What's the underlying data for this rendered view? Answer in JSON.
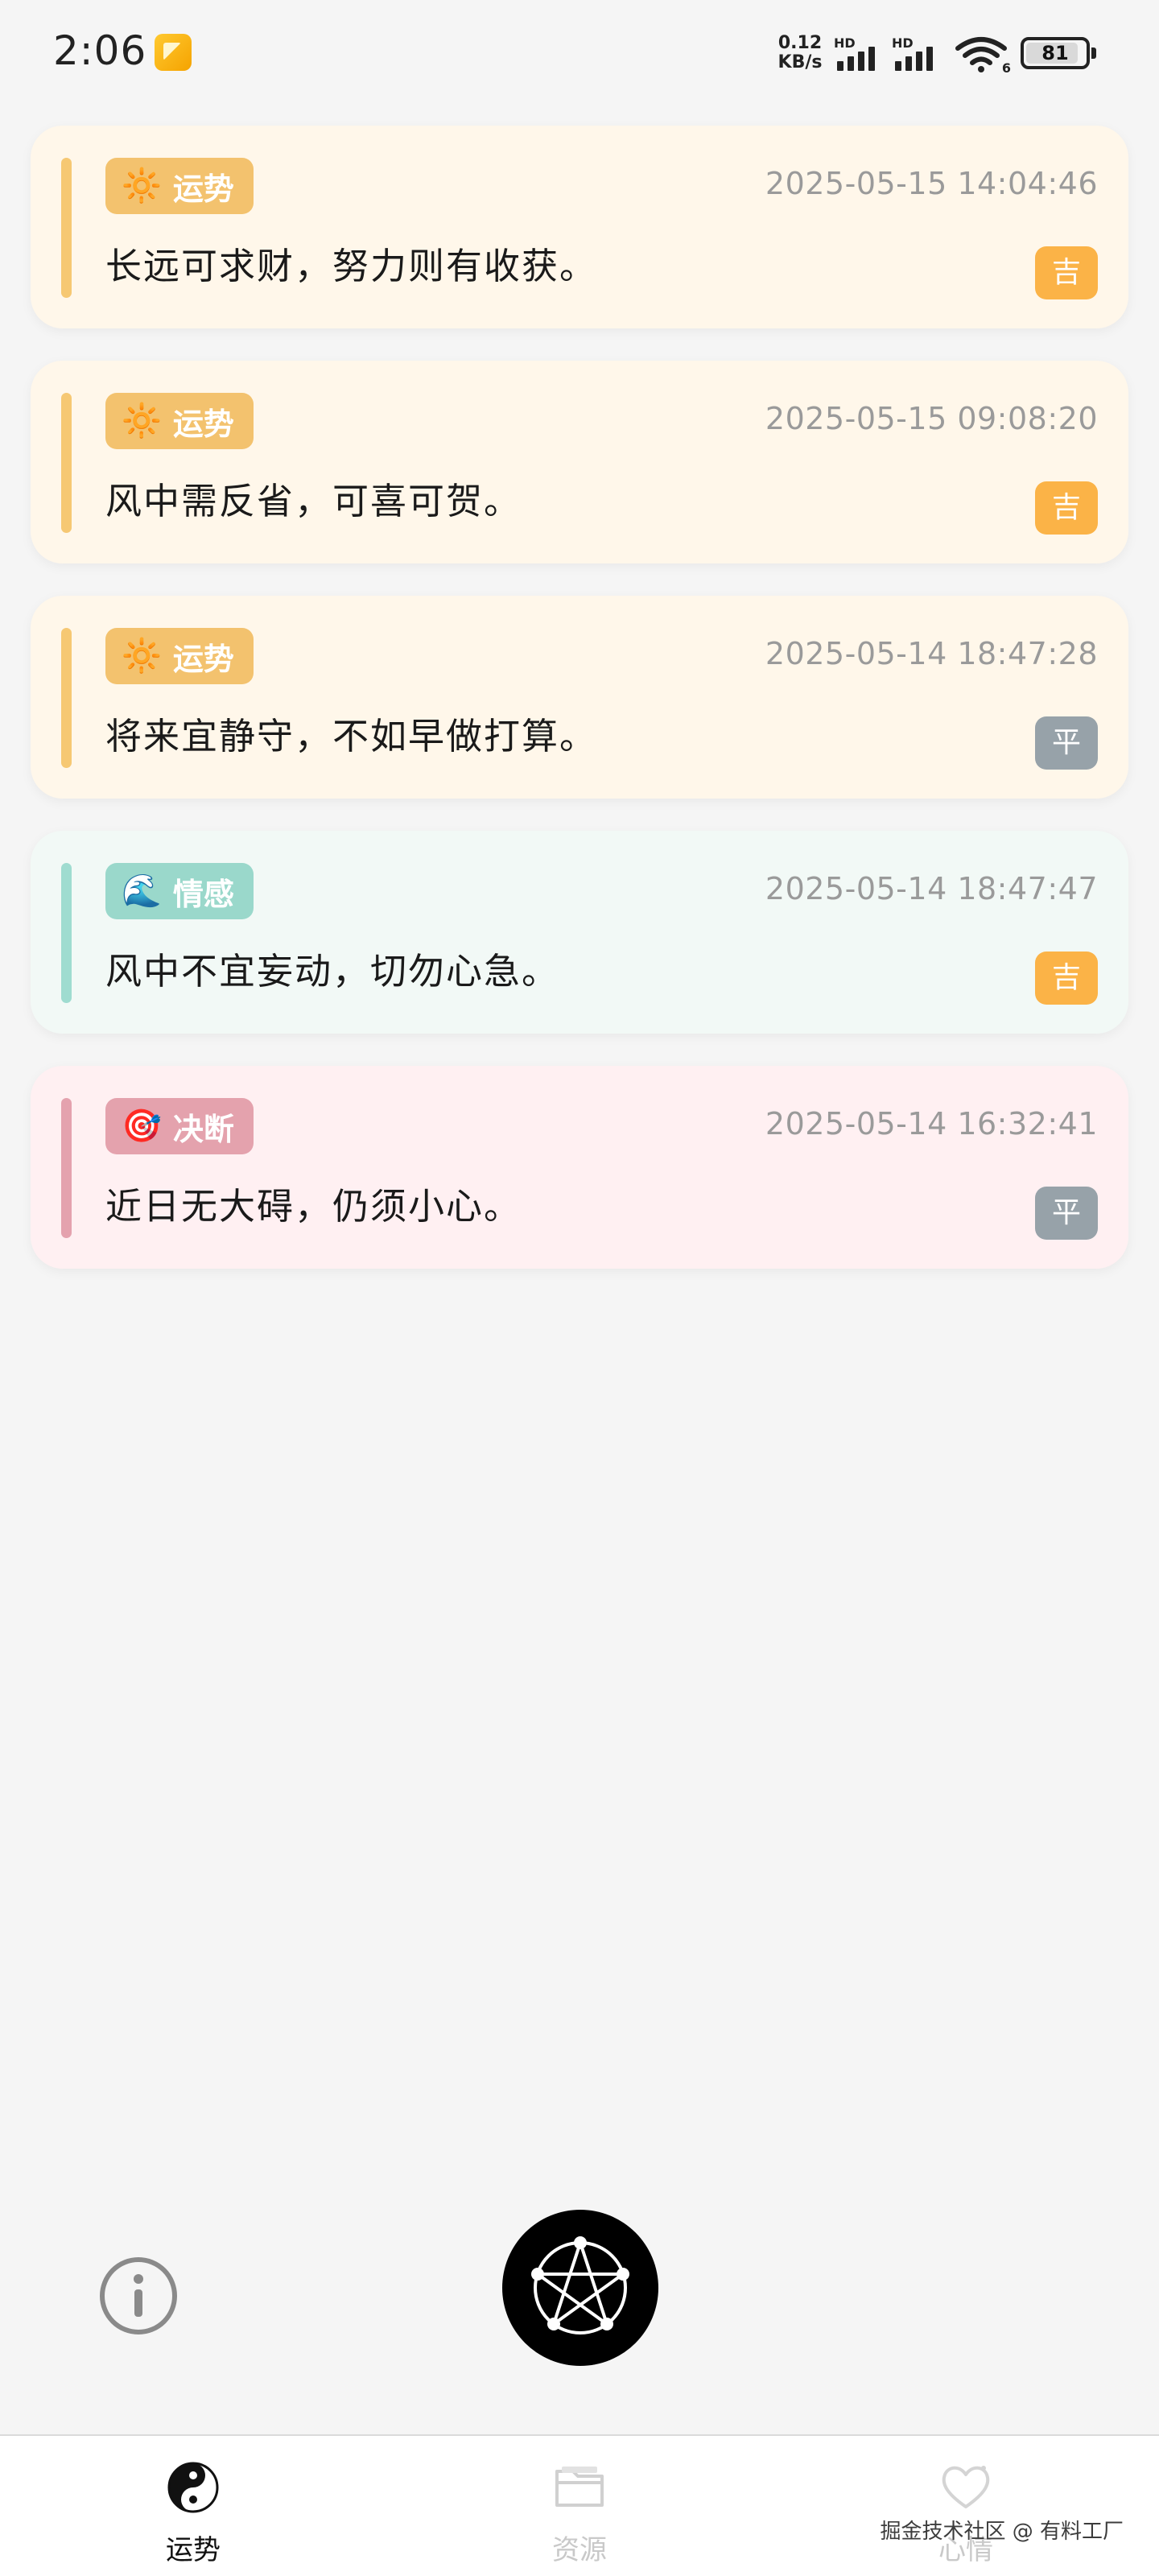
{
  "status_bar": {
    "time": "2:06",
    "net_speed_value": "0.12",
    "net_speed_unit": "KB/s",
    "hd_label_1": "HD",
    "hd_label_2": "HD",
    "wifi_badge": "6",
    "battery_level": "81"
  },
  "records": [
    {
      "category_icon": "sun-icon",
      "category_emoji": "🔆",
      "category": "运势",
      "timestamp": "2025-05-15 14:04:46",
      "message": "长远可求财，努力则有收获。",
      "result": "吉",
      "card_bg": "#fff7ea",
      "accent_color": "#f6c873",
      "badge_color": "#f3c26e",
      "result_color": "#fbb347"
    },
    {
      "category_icon": "sun-icon",
      "category_emoji": "🔆",
      "category": "运势",
      "timestamp": "2025-05-15 09:08:20",
      "message": "风中需反省，可喜可贺。",
      "result": "吉",
      "card_bg": "#fff7ea",
      "accent_color": "#f6c873",
      "badge_color": "#f3c26e",
      "result_color": "#fbb347"
    },
    {
      "category_icon": "sun-icon",
      "category_emoji": "🔆",
      "category": "运势",
      "timestamp": "2025-05-14 18:47:28",
      "message": "将来宜静守，不如早做打算。",
      "result": "平",
      "card_bg": "#fff7ea",
      "accent_color": "#f6c873",
      "badge_color": "#f3c26e",
      "result_color": "#97a2a9"
    },
    {
      "category_icon": "wave-icon",
      "category_emoji": "🌊",
      "category": "情感",
      "timestamp": "2025-05-14 18:47:47",
      "message": "风中不宜妄动，切勿心急。",
      "result": "吉",
      "card_bg": "#f2f9f6",
      "accent_color": "#9fdcd0",
      "badge_color": "#9ad8cb",
      "result_color": "#fbb347"
    },
    {
      "category_icon": "target-icon",
      "category_emoji": "🎯",
      "category": "决断",
      "timestamp": "2025-05-14 16:32:41",
      "message": "近日无大碍，仍须小心。",
      "result": "平",
      "card_bg": "#fff0f2",
      "accent_color": "#e4a2ae",
      "badge_color": "#e4a2ad",
      "result_color": "#97a2a9"
    }
  ],
  "tabs": [
    {
      "label": "运势",
      "icon": "yin-yang-icon",
      "active": true
    },
    {
      "label": "资源",
      "icon": "folder-icon",
      "active": false
    },
    {
      "label": "心情",
      "icon": "heart-icon",
      "active": false
    }
  ],
  "watermark": "掘金技术社区 @ 有料工厂",
  "colors": {
    "background": "#f5f5f5",
    "tab_active": "#111111",
    "tab_inactive": "#c9c9c9",
    "center_button": "#000000"
  }
}
